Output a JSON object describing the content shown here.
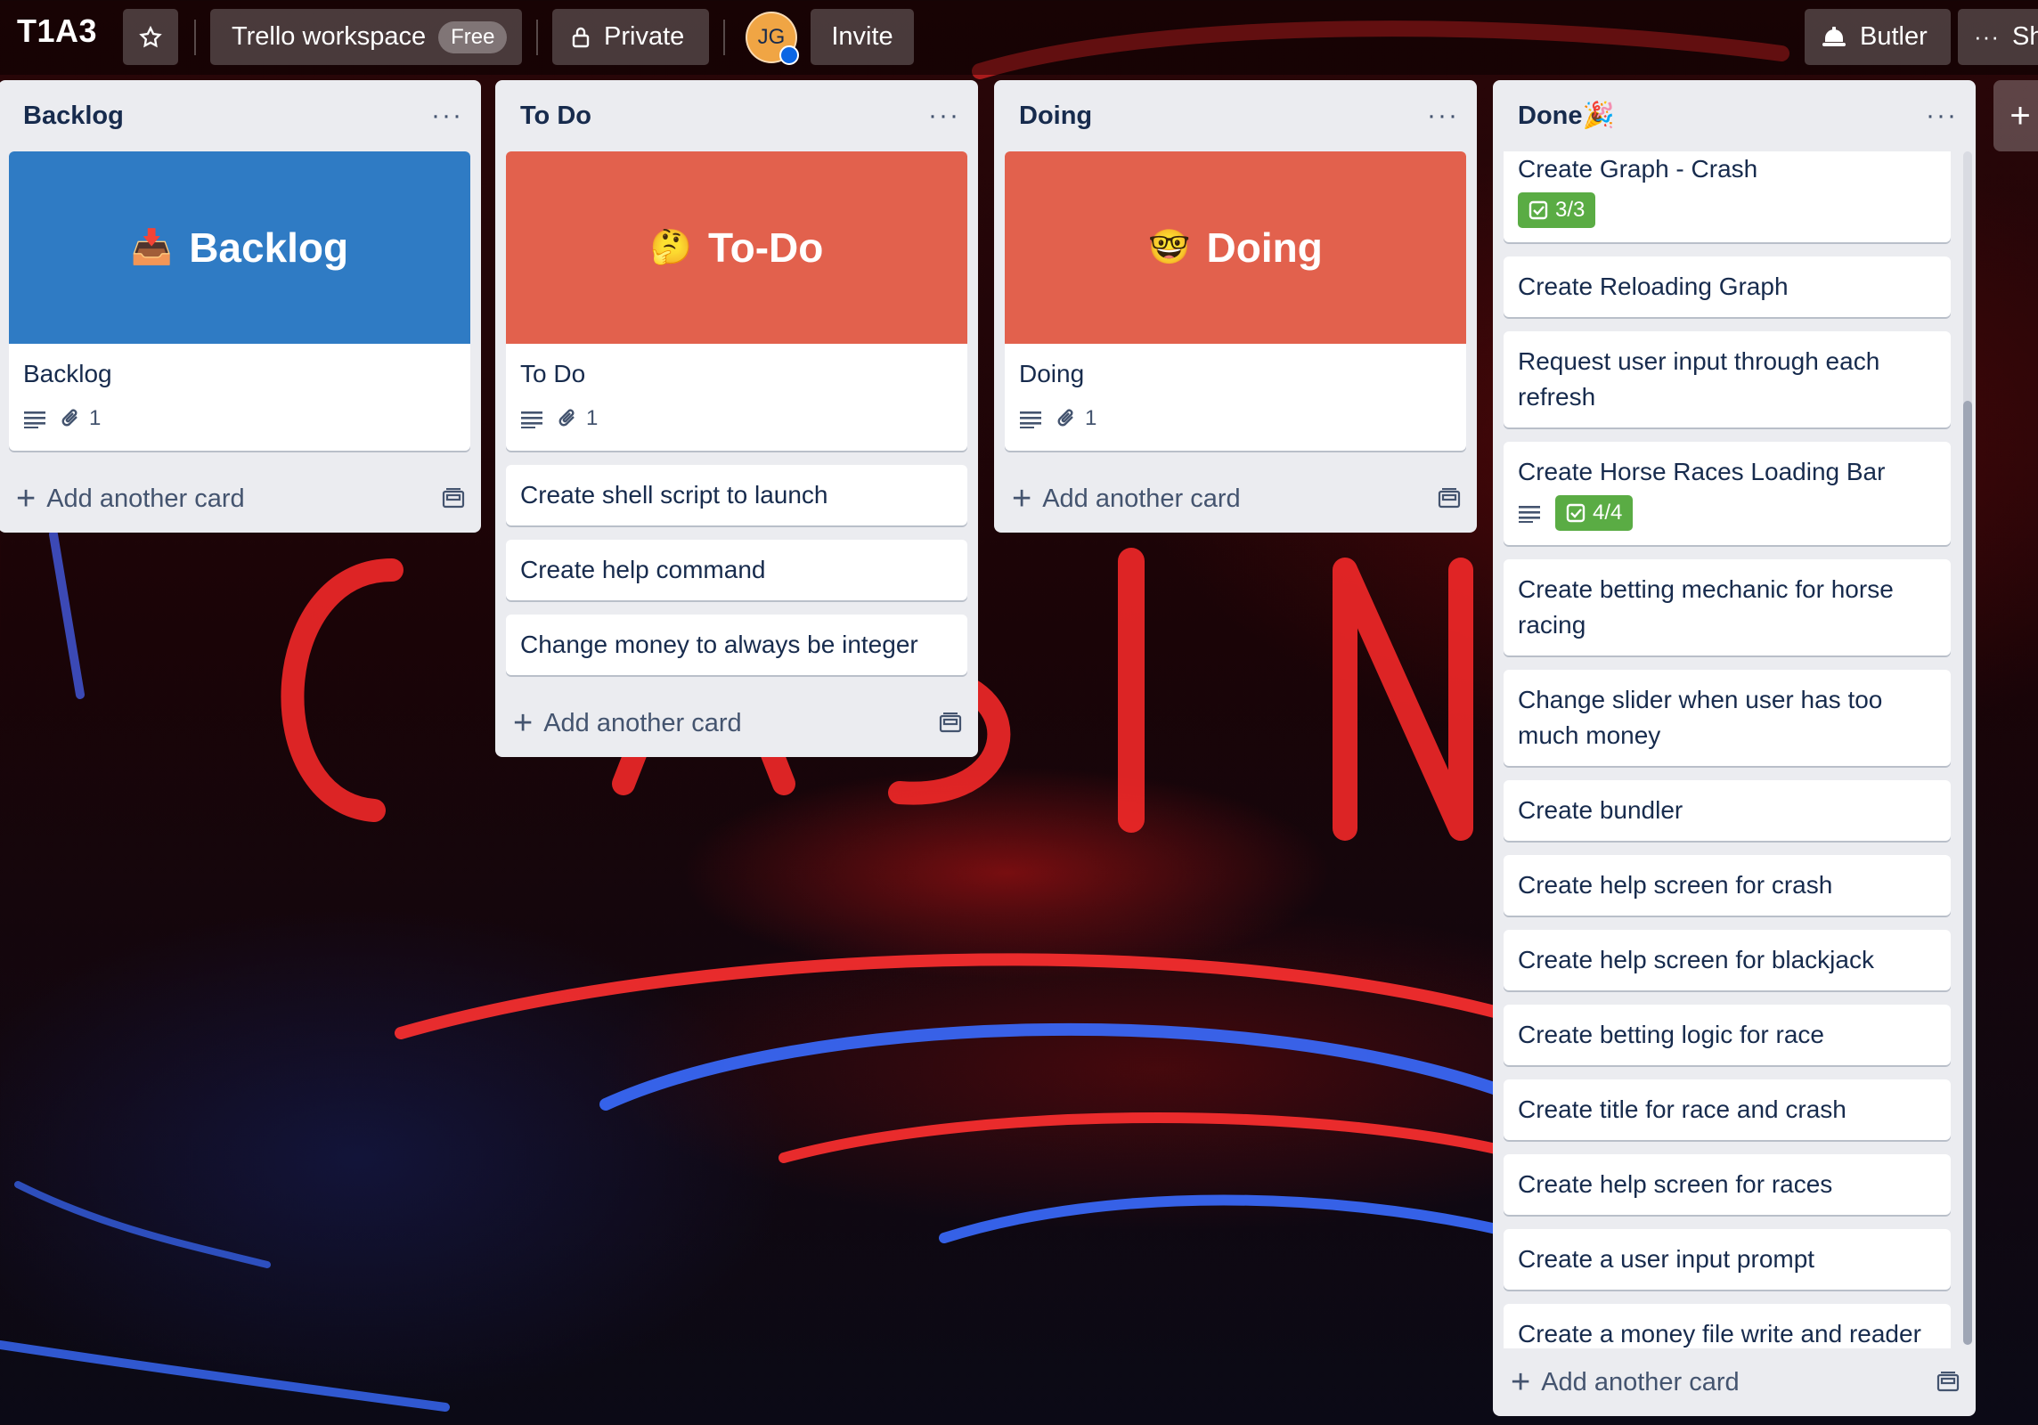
{
  "board": {
    "title": "T1A3",
    "workspace_label": "Trello workspace",
    "workspace_plan": "Free",
    "visibility": "Private",
    "member_initials": "JG",
    "invite_label": "Invite",
    "butler_label": "Butler",
    "more_label": "Sh",
    "add_list_label": "+"
  },
  "lists": [
    {
      "title": "Backlog",
      "cover": {
        "text": "Backlog",
        "color": "#2f7bc4",
        "emoji": "📥"
      },
      "cover_card": {
        "title": "Backlog",
        "attachments": "1"
      },
      "cards": [],
      "add_card": "Add another card"
    },
    {
      "title": "To Do",
      "cover": {
        "text": "To-Do",
        "color": "#e2614d",
        "emoji": "🤔"
      },
      "cover_card": {
        "title": "To Do",
        "attachments": "1"
      },
      "cards": [
        "Create shell script to launch",
        "Create help command",
        "Change money to always be integer"
      ],
      "add_card": "Add another card"
    },
    {
      "title": "Doing",
      "cover": {
        "text": "Doing",
        "color": "#e2614d",
        "emoji": "🤓"
      },
      "cover_card": {
        "title": "Doing",
        "attachments": "1"
      },
      "cards": [],
      "add_card": "Add another card"
    },
    {
      "title": "Done🎉",
      "cards": [
        {
          "title": "Create Graph - Crash",
          "checklist": "3/3"
        },
        {
          "title": "Create Reloading Graph"
        },
        {
          "title": "Request user input through each refresh"
        },
        {
          "title": "Create Horse Races Loading Bar",
          "has_description": true,
          "checklist": "4/4"
        },
        {
          "title": "Create betting mechanic for horse racing"
        },
        {
          "title": "Change slider when user has too much money"
        },
        {
          "title": "Create bundler"
        },
        {
          "title": "Create help screen for crash"
        },
        {
          "title": "Create help screen for blackjack"
        },
        {
          "title": "Create betting logic for race"
        },
        {
          "title": "Create title for race and crash"
        },
        {
          "title": "Create help screen for races"
        },
        {
          "title": "Create a user input prompt"
        },
        {
          "title": "Create a money file write and reader"
        }
      ],
      "add_card": "Add another card"
    }
  ],
  "colors": {
    "checklist_complete": "#5aac44",
    "list_bg": "#ebecf0"
  }
}
